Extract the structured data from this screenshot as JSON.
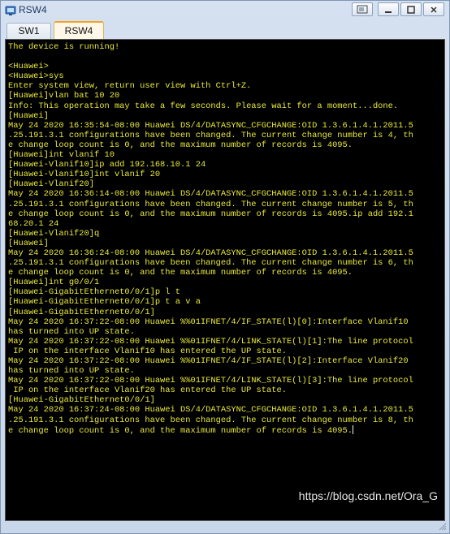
{
  "window": {
    "title": "RSW4"
  },
  "tabs": [
    {
      "label": "SW1"
    },
    {
      "label": "RSW4"
    }
  ],
  "terminal": {
    "lines": [
      "The device is running!",
      "",
      "<Huawei>",
      "<Huawei>sys",
      "Enter system view, return user view with Ctrl+Z.",
      "[Huawei]vlan bat 10 20",
      "Info: This operation may take a few seconds. Please wait for a moment...done.",
      "[Huawei]",
      "May 24 2020 16:35:54-08:00 Huawei DS/4/DATASYNC_CFGCHANGE:OID 1.3.6.1.4.1.2011.5",
      ".25.191.3.1 configurations have been changed. The current change number is 4, th",
      "e change loop count is 0, and the maximum number of records is 4095.",
      "[Huawei]int vlanif 10",
      "[Huawei-Vlanif10]ip add 192.168.10.1 24",
      "[Huawei-Vlanif10]int vlanif 20",
      "[Huawei-Vlanif20]",
      "May 24 2020 16:36:14-08:00 Huawei DS/4/DATASYNC_CFGCHANGE:OID 1.3.6.1.4.1.2011.5",
      ".25.191.3.1 configurations have been changed. The current change number is 5, th",
      "e change loop count is 0, and the maximum number of records is 4095.ip add 192.1",
      "68.20.1 24",
      "[Huawei-Vlanif20]q",
      "[Huawei]",
      "May 24 2020 16:36:24-08:00 Huawei DS/4/DATASYNC_CFGCHANGE:OID 1.3.6.1.4.1.2011.5",
      ".25.191.3.1 configurations have been changed. The current change number is 6, th",
      "e change loop count is 0, and the maximum number of records is 4095.",
      "[Huawei]int g0/0/1",
      "[Huawei-GigabitEthernet0/0/1]p l t",
      "[Huawei-GigabitEthernet0/0/1]p t a v a",
      "[Huawei-GigabitEthernet0/0/1]",
      "May 24 2020 16:37:22-08:00 Huawei %%01IFNET/4/IF_STATE(l)[0]:Interface Vlanif10",
      "has turned into UP state.",
      "May 24 2020 16:37:22-08:00 Huawei %%01IFNET/4/LINK_STATE(l)[1]:The line protocol",
      " IP on the interface Vlanif10 has entered the UP state.",
      "May 24 2020 16:37:22-08:00 Huawei %%01IFNET/4/IF_STATE(l)[2]:Interface Vlanif20",
      "has turned into UP state.",
      "May 24 2020 16:37:22-08:00 Huawei %%01IFNET/4/LINK_STATE(l)[3]:The line protocol",
      " IP on the interface Vlanif20 has entered the UP state.",
      "[Huawei-GigabitEthernet0/0/1]",
      "May 24 2020 16:37:24-08:00 Huawei DS/4/DATASYNC_CFGCHANGE:OID 1.3.6.1.4.1.2011.5",
      ".25.191.3.1 configurations have been changed. The current change number is 8, th",
      "e change loop count is 0, and the maximum number of records is 4095."
    ]
  },
  "watermark": "https://blog.csdn.net/Ora_G",
  "colors": {
    "terminal_bg": "#000000",
    "terminal_text": "#e9e93a",
    "active_tab_accent": "#f1a629"
  }
}
